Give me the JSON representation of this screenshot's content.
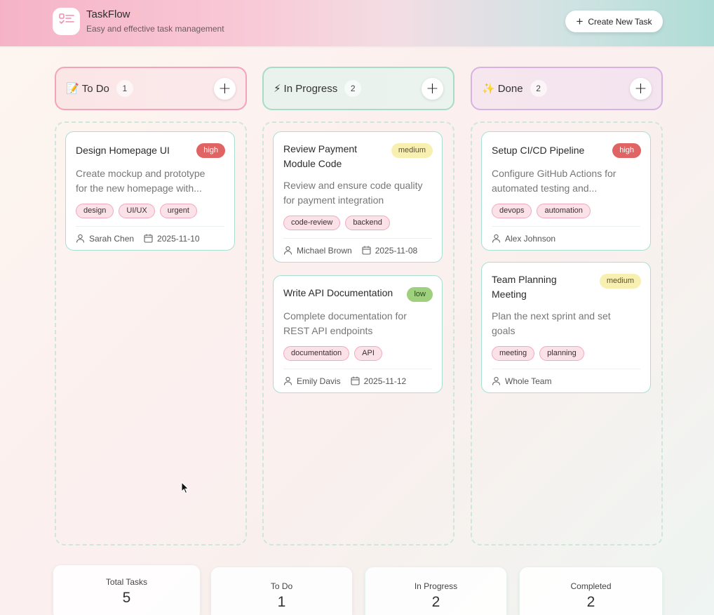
{
  "app": {
    "title": "TaskFlow",
    "subtitle": "Easy and effective task management",
    "create_label": "Create New Task",
    "logo_icon": "checklist-icon"
  },
  "columns": [
    {
      "emoji": "📝",
      "title": "To Do",
      "count": "1"
    },
    {
      "emoji": "⚡",
      "title": "In Progress",
      "count": "2"
    },
    {
      "emoji": "✨",
      "title": "Done",
      "count": "2"
    }
  ],
  "tasks": {
    "todo": [
      {
        "title": "Design Homepage UI",
        "priority": "high",
        "desc_line1": "Create mockup and prototype",
        "desc_line2": "for the new homepage with...",
        "tags": [
          "design",
          "UI/UX",
          "urgent"
        ],
        "assignee": "Sarah Chen",
        "date": "2025-11-10"
      }
    ],
    "progress": [
      {
        "title_line1": "Review Payment",
        "title_line2": "Module Code",
        "priority": "medium",
        "desc_line1": "Review and ensure code quality",
        "desc_line2": "for payment integration",
        "tags": [
          "code-review",
          "backend"
        ],
        "assignee": "Michael Brown",
        "date": "2025-11-08"
      },
      {
        "title": "Write API Documentation",
        "priority": "low",
        "desc_line1": "Complete documentation for",
        "desc_line2": "REST API endpoints",
        "tags": [
          "documentation",
          "API"
        ],
        "assignee": "Emily Davis",
        "date": "2025-11-12"
      }
    ],
    "done": [
      {
        "title": "Setup CI/CD Pipeline",
        "priority": "high",
        "desc_line1": "Configure GitHub Actions for",
        "desc_line2": "automated testing and...",
        "tags": [
          "devops",
          "automation"
        ],
        "assignee": "Alex Johnson"
      },
      {
        "title_line1": "Team Planning",
        "title_line2": "Meeting",
        "priority": "medium",
        "desc_line1": "Plan the next sprint and set",
        "desc_line2": "goals",
        "tags": [
          "meeting",
          "planning"
        ],
        "assignee": "Whole Team"
      }
    ]
  },
  "stats": [
    {
      "label": "Total Tasks",
      "value": "5"
    },
    {
      "label": "To Do",
      "value": "1"
    },
    {
      "label": "In Progress",
      "value": "2"
    },
    {
      "label": "Completed",
      "value": "2"
    }
  ],
  "colors": {
    "high": "#e06464",
    "medium": "#f8f0b0",
    "low": "#9ed07e",
    "todo_border": "#f3a4b8",
    "progress_border": "#a8dcc9",
    "done_border": "#d7b3e1"
  }
}
